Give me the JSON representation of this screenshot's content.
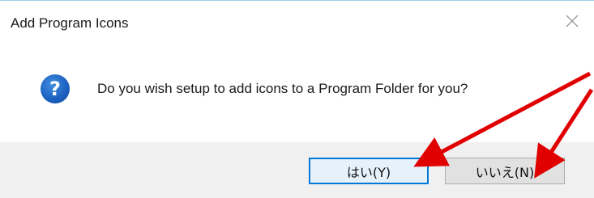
{
  "dialog": {
    "title": "Add Program Icons",
    "close_glyph": "✕",
    "icon": "question-icon",
    "icon_glyph": "?",
    "message": "Do you wish setup to add icons to a Program Folder for you?"
  },
  "buttons": {
    "yes_label": "はい(Y)",
    "no_label": "いいえ(N)"
  },
  "colors": {
    "accent": "#0078d7",
    "annotation_arrow": "#e00000"
  }
}
